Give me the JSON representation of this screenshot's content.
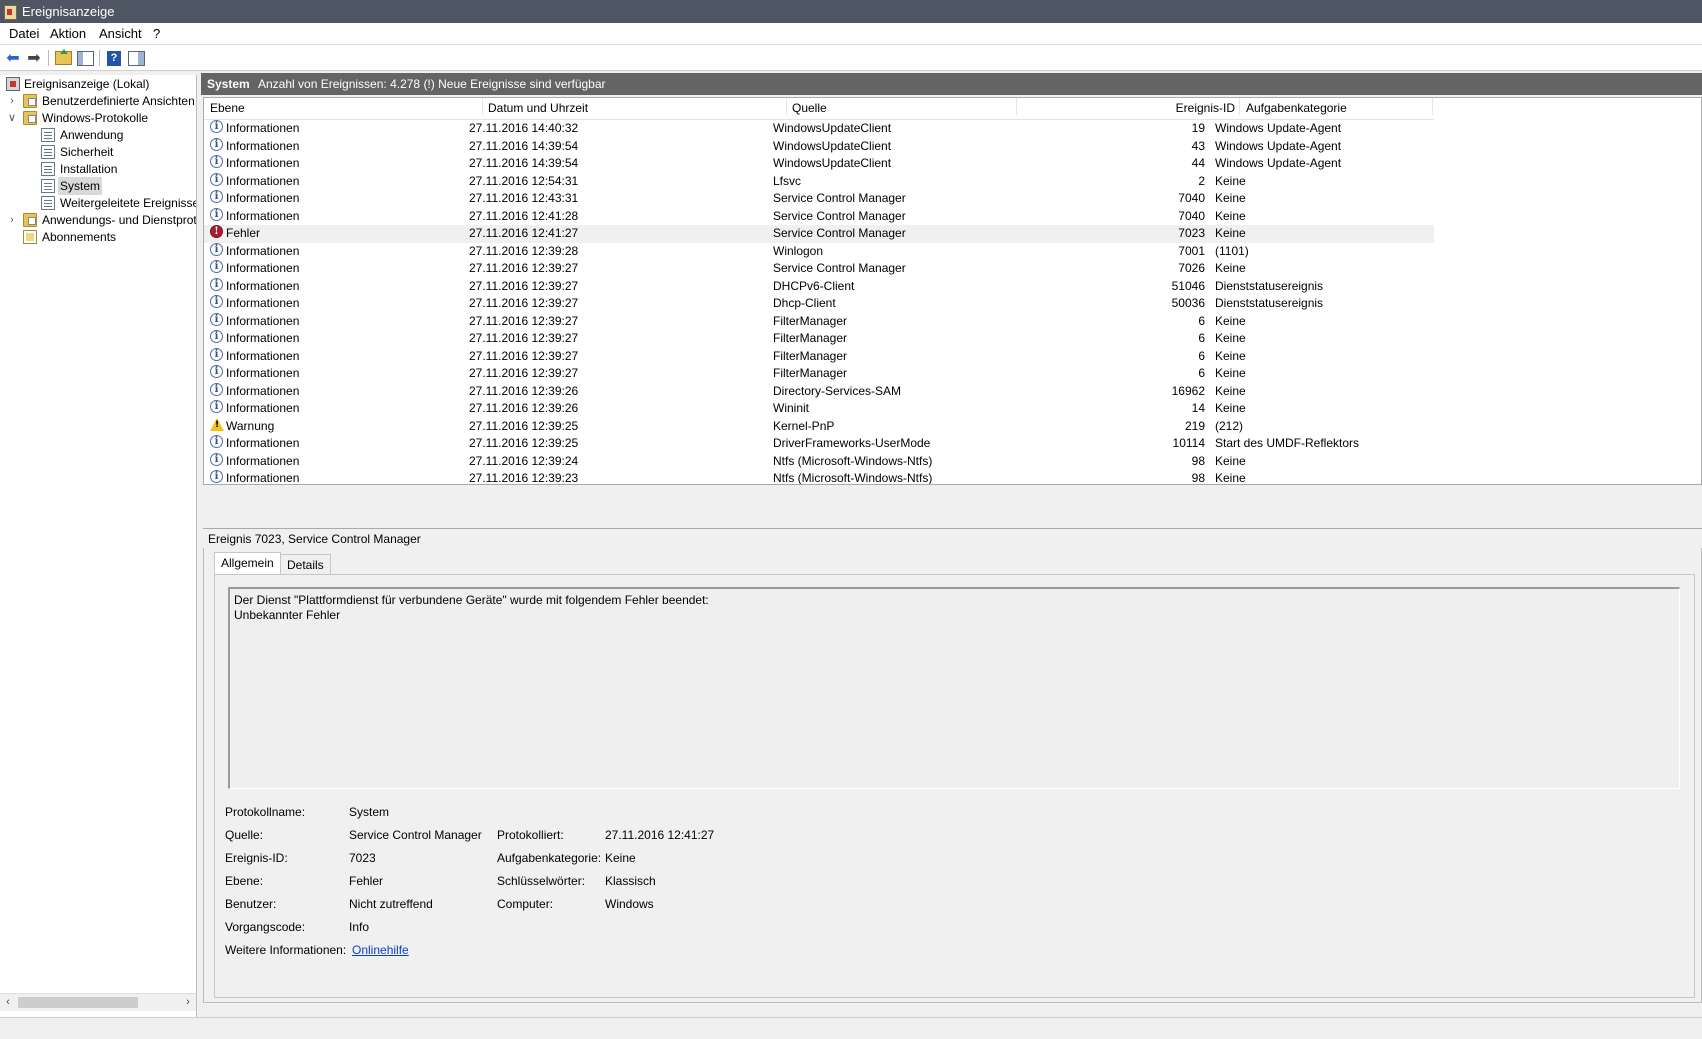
{
  "window": {
    "title": "Ereignisanzeige"
  },
  "menu": [
    "Datei",
    "Aktion",
    "Ansicht",
    "?"
  ],
  "tree": {
    "root": "Ereignisanzeige (Lokal)",
    "custom_views": "Benutzerdefinierte Ansichten",
    "windows_logs": "Windows-Protokolle",
    "logs": [
      "Anwendung",
      "Sicherheit",
      "Installation",
      "System",
      "Weitergeleitete Ereignisse"
    ],
    "app_services": "Anwendungs- und Dienstprotokolle",
    "subscriptions": "Abonnements",
    "selected": "System"
  },
  "list_header": {
    "log_name": "System",
    "count_text": "Anzahl von Ereignissen: 4.278 (!) Neue Ereignisse sind verfügbar"
  },
  "columns": [
    "Ebene",
    "Datum und Uhrzeit",
    "Quelle",
    "Ereignis-ID",
    "Aufgabenkategorie"
  ],
  "events": [
    {
      "level": "Informationen",
      "type": "info",
      "datetime": "27.11.2016 14:40:32",
      "source": "WindowsUpdateClient",
      "id": "19",
      "category": "Windows Update-Agent"
    },
    {
      "level": "Informationen",
      "type": "info",
      "datetime": "27.11.2016 14:39:54",
      "source": "WindowsUpdateClient",
      "id": "43",
      "category": "Windows Update-Agent"
    },
    {
      "level": "Informationen",
      "type": "info",
      "datetime": "27.11.2016 14:39:54",
      "source": "WindowsUpdateClient",
      "id": "44",
      "category": "Windows Update-Agent"
    },
    {
      "level": "Informationen",
      "type": "info",
      "datetime": "27.11.2016 12:54:31",
      "source": "Lfsvc",
      "id": "2",
      "category": "Keine"
    },
    {
      "level": "Informationen",
      "type": "info",
      "datetime": "27.11.2016 12:43:31",
      "source": "Service Control Manager",
      "id": "7040",
      "category": "Keine"
    },
    {
      "level": "Informationen",
      "type": "info",
      "datetime": "27.11.2016 12:41:28",
      "source": "Service Control Manager",
      "id": "7040",
      "category": "Keine"
    },
    {
      "level": "Fehler",
      "type": "error",
      "datetime": "27.11.2016 12:41:27",
      "source": "Service Control Manager",
      "id": "7023",
      "category": "Keine",
      "selected": true
    },
    {
      "level": "Informationen",
      "type": "info",
      "datetime": "27.11.2016 12:39:28",
      "source": "Winlogon",
      "id": "7001",
      "category": "(1101)"
    },
    {
      "level": "Informationen",
      "type": "info",
      "datetime": "27.11.2016 12:39:27",
      "source": "Service Control Manager",
      "id": "7026",
      "category": "Keine"
    },
    {
      "level": "Informationen",
      "type": "info",
      "datetime": "27.11.2016 12:39:27",
      "source": "DHCPv6-Client",
      "id": "51046",
      "category": "Dienststatusereignis"
    },
    {
      "level": "Informationen",
      "type": "info",
      "datetime": "27.11.2016 12:39:27",
      "source": "Dhcp-Client",
      "id": "50036",
      "category": "Dienststatusereignis"
    },
    {
      "level": "Informationen",
      "type": "info",
      "datetime": "27.11.2016 12:39:27",
      "source": "FilterManager",
      "id": "6",
      "category": "Keine"
    },
    {
      "level": "Informationen",
      "type": "info",
      "datetime": "27.11.2016 12:39:27",
      "source": "FilterManager",
      "id": "6",
      "category": "Keine"
    },
    {
      "level": "Informationen",
      "type": "info",
      "datetime": "27.11.2016 12:39:27",
      "source": "FilterManager",
      "id": "6",
      "category": "Keine"
    },
    {
      "level": "Informationen",
      "type": "info",
      "datetime": "27.11.2016 12:39:27",
      "source": "FilterManager",
      "id": "6",
      "category": "Keine"
    },
    {
      "level": "Informationen",
      "type": "info",
      "datetime": "27.11.2016 12:39:26",
      "source": "Directory-Services-SAM",
      "id": "16962",
      "category": "Keine"
    },
    {
      "level": "Informationen",
      "type": "info",
      "datetime": "27.11.2016 12:39:26",
      "source": "Wininit",
      "id": "14",
      "category": "Keine"
    },
    {
      "level": "Warnung",
      "type": "warning",
      "datetime": "27.11.2016 12:39:25",
      "source": "Kernel-PnP",
      "id": "219",
      "category": "(212)"
    },
    {
      "level": "Informationen",
      "type": "info",
      "datetime": "27.11.2016 12:39:25",
      "source": "DriverFrameworks-UserMode",
      "id": "10114",
      "category": "Start des UMDF-Reflektors"
    },
    {
      "level": "Informationen",
      "type": "info",
      "datetime": "27.11.2016 12:39:24",
      "source": "Ntfs (Microsoft-Windows-Ntfs)",
      "id": "98",
      "category": "Keine"
    },
    {
      "level": "Informationen",
      "type": "info",
      "datetime": "27.11.2016 12:39:23",
      "source": "Ntfs (Microsoft-Windows-Ntfs)",
      "id": "98",
      "category": "Keine"
    }
  ],
  "detail": {
    "header": "Ereignis 7023, Service Control Manager",
    "tabs": [
      "Allgemein",
      "Details"
    ],
    "description_line1": "Der Dienst \"Plattformdienst für verbundene Geräte\" wurde mit folgendem Fehler beendet:",
    "description_line2": "Unbekannter Fehler",
    "fields": {
      "log_label": "Protokollname:",
      "log_value": "System",
      "source_label": "Quelle:",
      "source_value": "Service Control Manager",
      "logged_label": "Protokolliert:",
      "logged_value": "27.11.2016 12:41:27",
      "id_label": "Ereignis-ID:",
      "id_value": "7023",
      "category_label": "Aufgabenkategorie:",
      "category_value": "Keine",
      "level_label": "Ebene:",
      "level_value": "Fehler",
      "keywords_label": "Schlüsselwörter:",
      "keywords_value": "Klassisch",
      "user_label": "Benutzer:",
      "user_value": "Nicht zutreffend",
      "computer_label": "Computer:",
      "computer_value": "Windows",
      "opcode_label": "Vorgangscode:",
      "opcode_value": "Info",
      "more_label": "Weitere Informationen:",
      "more_link": "Onlinehilfe"
    }
  },
  "colors": {
    "titlebar": "#4d5662",
    "list_header": "#646464",
    "link": "#0a3fc7",
    "error_icon": "#a8202f",
    "warning_icon": "#f2c319"
  }
}
